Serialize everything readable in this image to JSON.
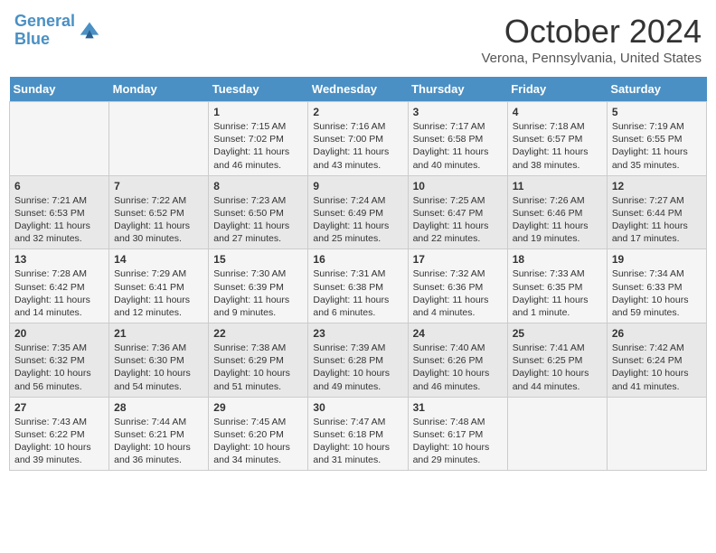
{
  "header": {
    "logo_general": "General",
    "logo_blue": "Blue",
    "month_title": "October 2024",
    "location": "Verona, Pennsylvania, United States"
  },
  "weekdays": [
    "Sunday",
    "Monday",
    "Tuesday",
    "Wednesday",
    "Thursday",
    "Friday",
    "Saturday"
  ],
  "weeks": [
    [
      {
        "day": "",
        "text": ""
      },
      {
        "day": "",
        "text": ""
      },
      {
        "day": "1",
        "text": "Sunrise: 7:15 AM\nSunset: 7:02 PM\nDaylight: 11 hours and 46 minutes."
      },
      {
        "day": "2",
        "text": "Sunrise: 7:16 AM\nSunset: 7:00 PM\nDaylight: 11 hours and 43 minutes."
      },
      {
        "day": "3",
        "text": "Sunrise: 7:17 AM\nSunset: 6:58 PM\nDaylight: 11 hours and 40 minutes."
      },
      {
        "day": "4",
        "text": "Sunrise: 7:18 AM\nSunset: 6:57 PM\nDaylight: 11 hours and 38 minutes."
      },
      {
        "day": "5",
        "text": "Sunrise: 7:19 AM\nSunset: 6:55 PM\nDaylight: 11 hours and 35 minutes."
      }
    ],
    [
      {
        "day": "6",
        "text": "Sunrise: 7:21 AM\nSunset: 6:53 PM\nDaylight: 11 hours and 32 minutes."
      },
      {
        "day": "7",
        "text": "Sunrise: 7:22 AM\nSunset: 6:52 PM\nDaylight: 11 hours and 30 minutes."
      },
      {
        "day": "8",
        "text": "Sunrise: 7:23 AM\nSunset: 6:50 PM\nDaylight: 11 hours and 27 minutes."
      },
      {
        "day": "9",
        "text": "Sunrise: 7:24 AM\nSunset: 6:49 PM\nDaylight: 11 hours and 25 minutes."
      },
      {
        "day": "10",
        "text": "Sunrise: 7:25 AM\nSunset: 6:47 PM\nDaylight: 11 hours and 22 minutes."
      },
      {
        "day": "11",
        "text": "Sunrise: 7:26 AM\nSunset: 6:46 PM\nDaylight: 11 hours and 19 minutes."
      },
      {
        "day": "12",
        "text": "Sunrise: 7:27 AM\nSunset: 6:44 PM\nDaylight: 11 hours and 17 minutes."
      }
    ],
    [
      {
        "day": "13",
        "text": "Sunrise: 7:28 AM\nSunset: 6:42 PM\nDaylight: 11 hours and 14 minutes."
      },
      {
        "day": "14",
        "text": "Sunrise: 7:29 AM\nSunset: 6:41 PM\nDaylight: 11 hours and 12 minutes."
      },
      {
        "day": "15",
        "text": "Sunrise: 7:30 AM\nSunset: 6:39 PM\nDaylight: 11 hours and 9 minutes."
      },
      {
        "day": "16",
        "text": "Sunrise: 7:31 AM\nSunset: 6:38 PM\nDaylight: 11 hours and 6 minutes."
      },
      {
        "day": "17",
        "text": "Sunrise: 7:32 AM\nSunset: 6:36 PM\nDaylight: 11 hours and 4 minutes."
      },
      {
        "day": "18",
        "text": "Sunrise: 7:33 AM\nSunset: 6:35 PM\nDaylight: 11 hours and 1 minute."
      },
      {
        "day": "19",
        "text": "Sunrise: 7:34 AM\nSunset: 6:33 PM\nDaylight: 10 hours and 59 minutes."
      }
    ],
    [
      {
        "day": "20",
        "text": "Sunrise: 7:35 AM\nSunset: 6:32 PM\nDaylight: 10 hours and 56 minutes."
      },
      {
        "day": "21",
        "text": "Sunrise: 7:36 AM\nSunset: 6:30 PM\nDaylight: 10 hours and 54 minutes."
      },
      {
        "day": "22",
        "text": "Sunrise: 7:38 AM\nSunset: 6:29 PM\nDaylight: 10 hours and 51 minutes."
      },
      {
        "day": "23",
        "text": "Sunrise: 7:39 AM\nSunset: 6:28 PM\nDaylight: 10 hours and 49 minutes."
      },
      {
        "day": "24",
        "text": "Sunrise: 7:40 AM\nSunset: 6:26 PM\nDaylight: 10 hours and 46 minutes."
      },
      {
        "day": "25",
        "text": "Sunrise: 7:41 AM\nSunset: 6:25 PM\nDaylight: 10 hours and 44 minutes."
      },
      {
        "day": "26",
        "text": "Sunrise: 7:42 AM\nSunset: 6:24 PM\nDaylight: 10 hours and 41 minutes."
      }
    ],
    [
      {
        "day": "27",
        "text": "Sunrise: 7:43 AM\nSunset: 6:22 PM\nDaylight: 10 hours and 39 minutes."
      },
      {
        "day": "28",
        "text": "Sunrise: 7:44 AM\nSunset: 6:21 PM\nDaylight: 10 hours and 36 minutes."
      },
      {
        "day": "29",
        "text": "Sunrise: 7:45 AM\nSunset: 6:20 PM\nDaylight: 10 hours and 34 minutes."
      },
      {
        "day": "30",
        "text": "Sunrise: 7:47 AM\nSunset: 6:18 PM\nDaylight: 10 hours and 31 minutes."
      },
      {
        "day": "31",
        "text": "Sunrise: 7:48 AM\nSunset: 6:17 PM\nDaylight: 10 hours and 29 minutes."
      },
      {
        "day": "",
        "text": ""
      },
      {
        "day": "",
        "text": ""
      }
    ]
  ]
}
